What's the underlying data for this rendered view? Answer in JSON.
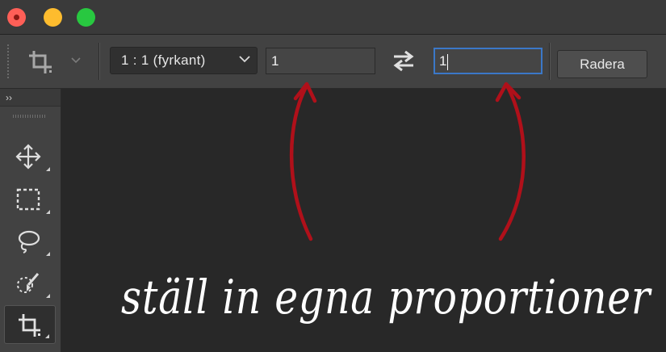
{
  "window": {
    "controls": [
      "close",
      "minimize",
      "zoom"
    ]
  },
  "options_bar": {
    "tool_preset_icon": "crop-icon",
    "aspect_ratio": "1 : 1 (fyrkant)",
    "width_value": "1",
    "swap_icon": "swap-arrows-icon",
    "height_value": "1",
    "clear_label": "Radera"
  },
  "toolbox": {
    "collapse_label": "››",
    "tools": [
      {
        "name": "move-tool",
        "icon": "move-icon",
        "active": false
      },
      {
        "name": "marquee-tool",
        "icon": "marquee-icon",
        "active": false
      },
      {
        "name": "lasso-tool",
        "icon": "lasso-icon",
        "active": false
      },
      {
        "name": "quick-selection-tool",
        "icon": "quick-selection-icon",
        "active": false
      },
      {
        "name": "crop-tool",
        "icon": "crop-icon",
        "active": true
      }
    ]
  },
  "annotation": {
    "caption": "ställ in egna proportioner",
    "arrow_color": "#b0101a"
  },
  "colors": {
    "focus_border": "#3b78c8",
    "canvas": "#282828",
    "panel": "#424242"
  }
}
